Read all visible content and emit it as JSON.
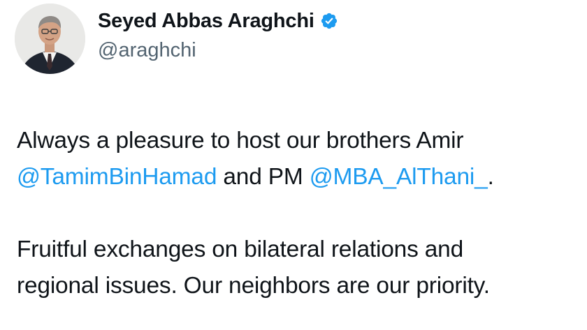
{
  "author": {
    "display_name": "Seyed Abbas Araghchi",
    "handle": "@araghchi",
    "verified_icon": "verified-badge-icon",
    "avatar": "profile-photo"
  },
  "tweet": {
    "p1_l1": "Always a pleasure to host our brothers Amir",
    "p1_mention1": "@TamimBinHamad",
    "p1_mid": " and PM ",
    "p1_mention2": "@MBA_AlThani_",
    "p1_end": ".",
    "p2_l1": "Fruitful exchanges on bilateral relations and",
    "p2_l2": "regional issues. Our neighbors are our priority."
  },
  "colors": {
    "link": "#1d9bf0",
    "text": "#0f1419",
    "secondary": "#536471",
    "verified": "#1d9bf0"
  }
}
